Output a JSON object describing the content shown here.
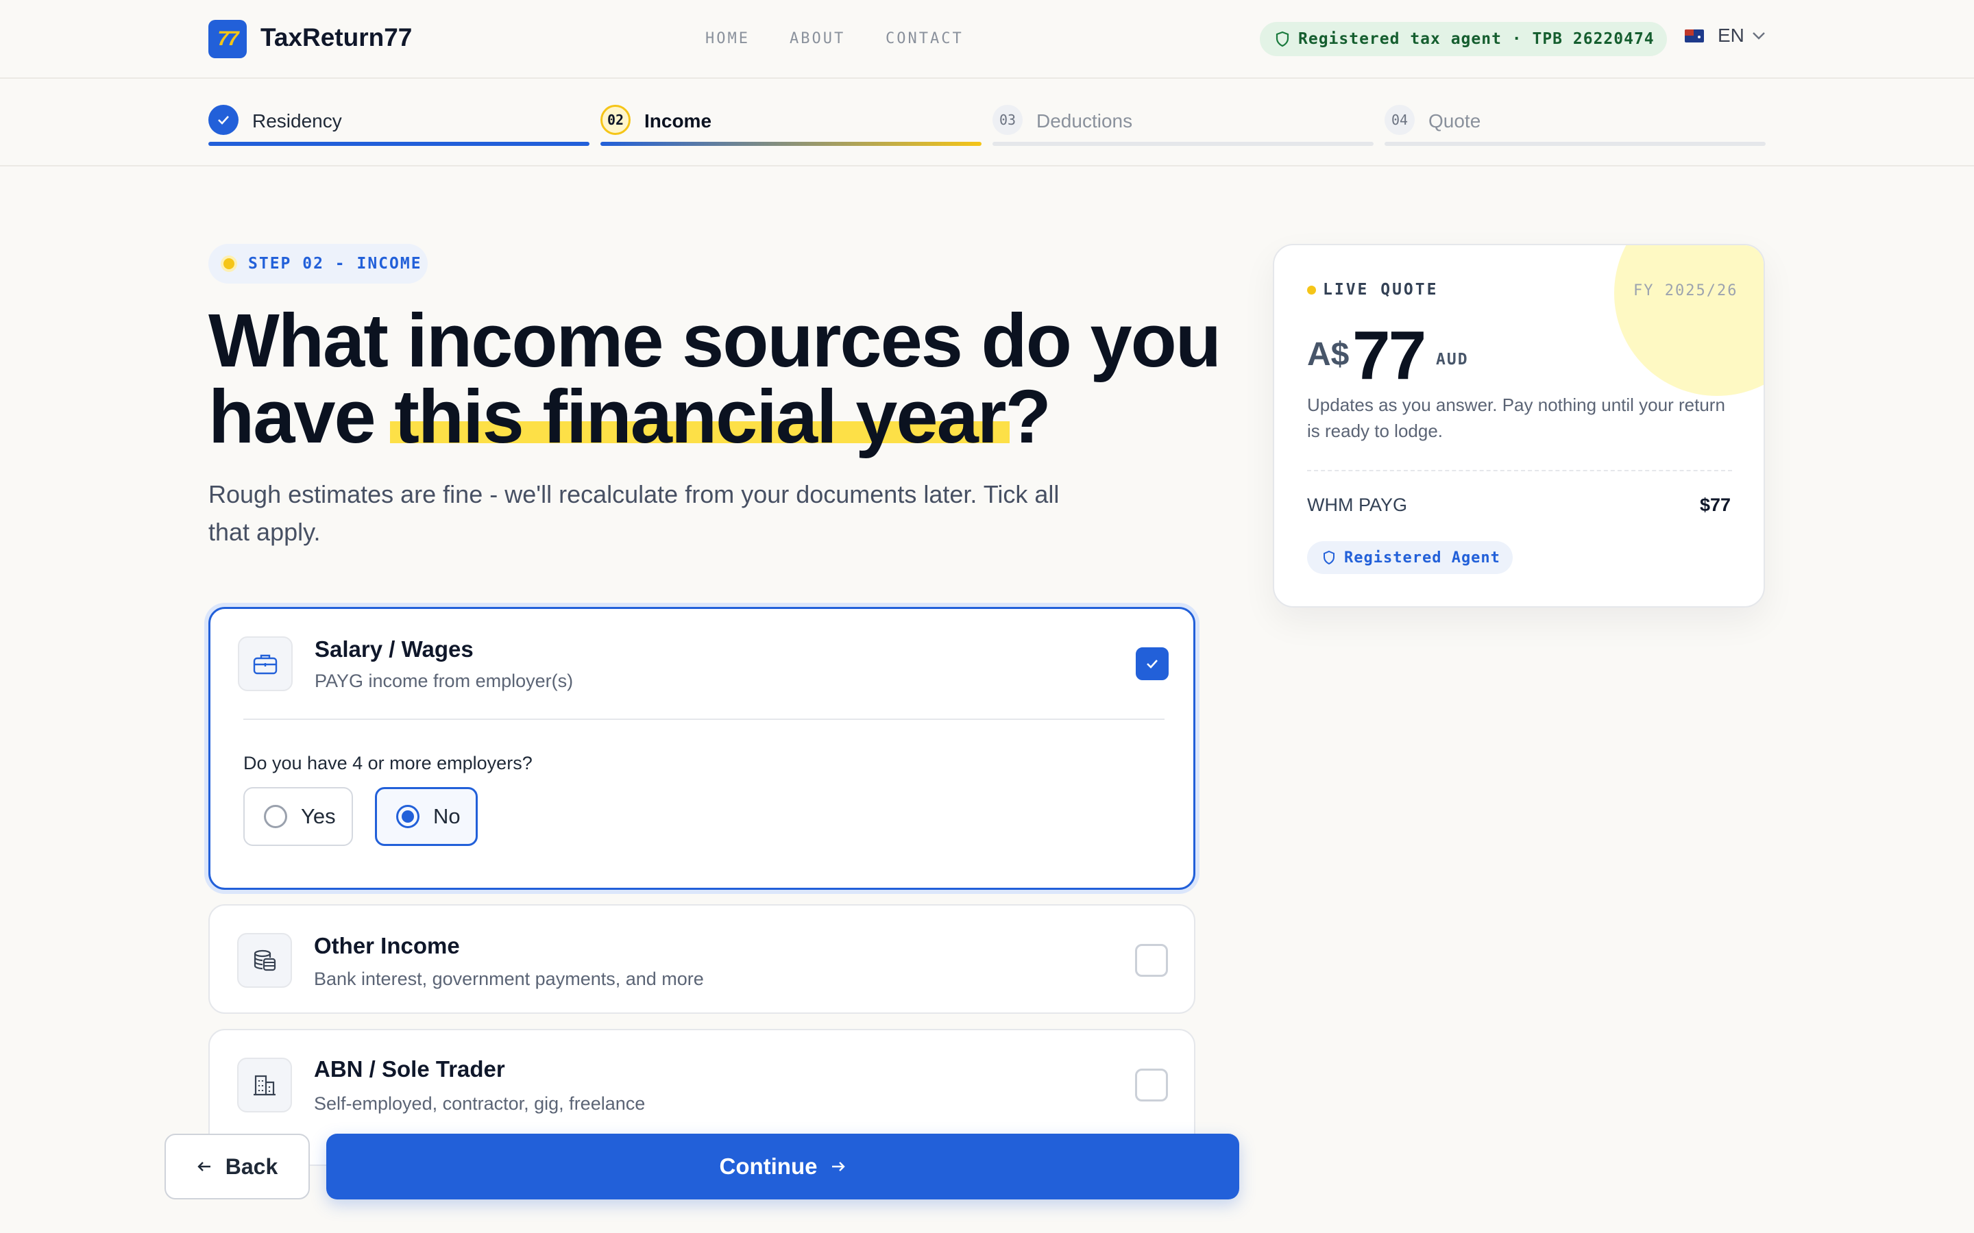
{
  "brand": {
    "logo_text": "77",
    "name": "TaxReturn77"
  },
  "nav": [
    "HOME",
    "ABOUT",
    "CONTACT"
  ],
  "agent_badge": "Registered tax agent · TPB 26220474",
  "language": "EN",
  "stepper": [
    {
      "num": "✓",
      "label": "Residency",
      "state": "done"
    },
    {
      "num": "02",
      "label": "Income",
      "state": "current"
    },
    {
      "num": "03",
      "label": "Deductions",
      "state": "todo"
    },
    {
      "num": "04",
      "label": "Quote",
      "state": "todo"
    }
  ],
  "step_badge": "STEP 02 - INCOME",
  "headline": {
    "line1": "What income sources do you",
    "line2_before": "have ",
    "line2_highlight": "this financial year",
    "line2_after": "?"
  },
  "subtitle": "Rough estimates are fine - we'll recalculate from your documents later. Tick all that apply.",
  "income_options": [
    {
      "title": "Salary / Wages",
      "desc": "PAYG income from employer(s)",
      "checked": true,
      "icon": "briefcase-icon",
      "question": "Do you have 4 or more employers?",
      "answers": [
        "Yes",
        "No"
      ],
      "selected_answer": "No"
    },
    {
      "title": "Other Income",
      "desc": "Bank interest, government payments, and more",
      "checked": false,
      "icon": "coins-icon"
    },
    {
      "title": "ABN / Sole Trader",
      "desc": "Self-employed, contractor, gig, freelance",
      "checked": false,
      "icon": "building-icon"
    }
  ],
  "buttons": {
    "back": "Back",
    "continue": "Continue"
  },
  "quote": {
    "label": "LIVE QUOTE",
    "fy": "FY 2025/26",
    "currency": "A$",
    "amount": "77",
    "unit": "AUD",
    "note": "Updates as you answer. Pay nothing until your return is ready to lodge.",
    "item_label": "WHM PAYG",
    "item_value": "$77",
    "badge": "Registered Agent"
  },
  "colors": {
    "accent": "#2260d9",
    "highlight": "#fde047",
    "success_bg": "#e3f3e6"
  }
}
